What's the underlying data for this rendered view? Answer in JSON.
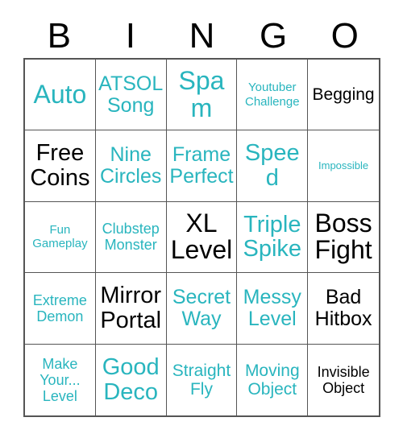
{
  "card": {
    "title": "BINGO",
    "header_letters": [
      "B",
      "I",
      "N",
      "G",
      "O"
    ],
    "colors": {
      "teal": "#29b5be",
      "black": "#000000",
      "border": "#555555",
      "background": "#ffffff"
    },
    "cells": [
      {
        "text": "Auto",
        "color": "teal",
        "size": "fs-3xl"
      },
      {
        "text": "ATSOL Song",
        "color": "teal",
        "size": "fs-xl"
      },
      {
        "text": "Spam",
        "color": "teal",
        "size": "fs-3xl"
      },
      {
        "text": "Youtuber Challenge",
        "color": "teal",
        "size": "fs-sm"
      },
      {
        "text": "Begging",
        "color": "black",
        "size": "fs-lg"
      },
      {
        "text": "Free Coins",
        "color": "black",
        "size": "fs-2xl"
      },
      {
        "text": "Nine Circles",
        "color": "teal",
        "size": "fs-xl"
      },
      {
        "text": "Frame Perfect",
        "color": "teal",
        "size": "fs-xl"
      },
      {
        "text": "Speed",
        "color": "teal",
        "size": "fs-2xl"
      },
      {
        "text": "Impossible",
        "color": "teal",
        "size": "fs-xs"
      },
      {
        "text": "Fun Gameplay",
        "color": "teal",
        "size": "fs-sm"
      },
      {
        "text": "Clubstep Monster",
        "color": "teal",
        "size": "fs-md"
      },
      {
        "text": "XL Level",
        "color": "black",
        "size": "fs-3xl"
      },
      {
        "text": "Triple Spike",
        "color": "teal",
        "size": "fs-2xl"
      },
      {
        "text": "Boss Fight",
        "color": "black",
        "size": "fs-3xl"
      },
      {
        "text": "Extreme Demon",
        "color": "teal",
        "size": "fs-md"
      },
      {
        "text": "Mirror Portal",
        "color": "black",
        "size": "fs-2xl"
      },
      {
        "text": "Secret Way",
        "color": "teal",
        "size": "fs-xl"
      },
      {
        "text": "Messy Level",
        "color": "teal",
        "size": "fs-xl"
      },
      {
        "text": "Bad Hitbox",
        "color": "black",
        "size": "fs-xl"
      },
      {
        "text": "Make Your... Level",
        "color": "teal",
        "size": "fs-md"
      },
      {
        "text": "Good Deco",
        "color": "teal",
        "size": "fs-2xl"
      },
      {
        "text": "Straight Fly",
        "color": "teal",
        "size": "fs-lg"
      },
      {
        "text": "Moving Object",
        "color": "teal",
        "size": "fs-lg"
      },
      {
        "text": "Invisible Object",
        "color": "black",
        "size": "fs-md"
      }
    ]
  }
}
